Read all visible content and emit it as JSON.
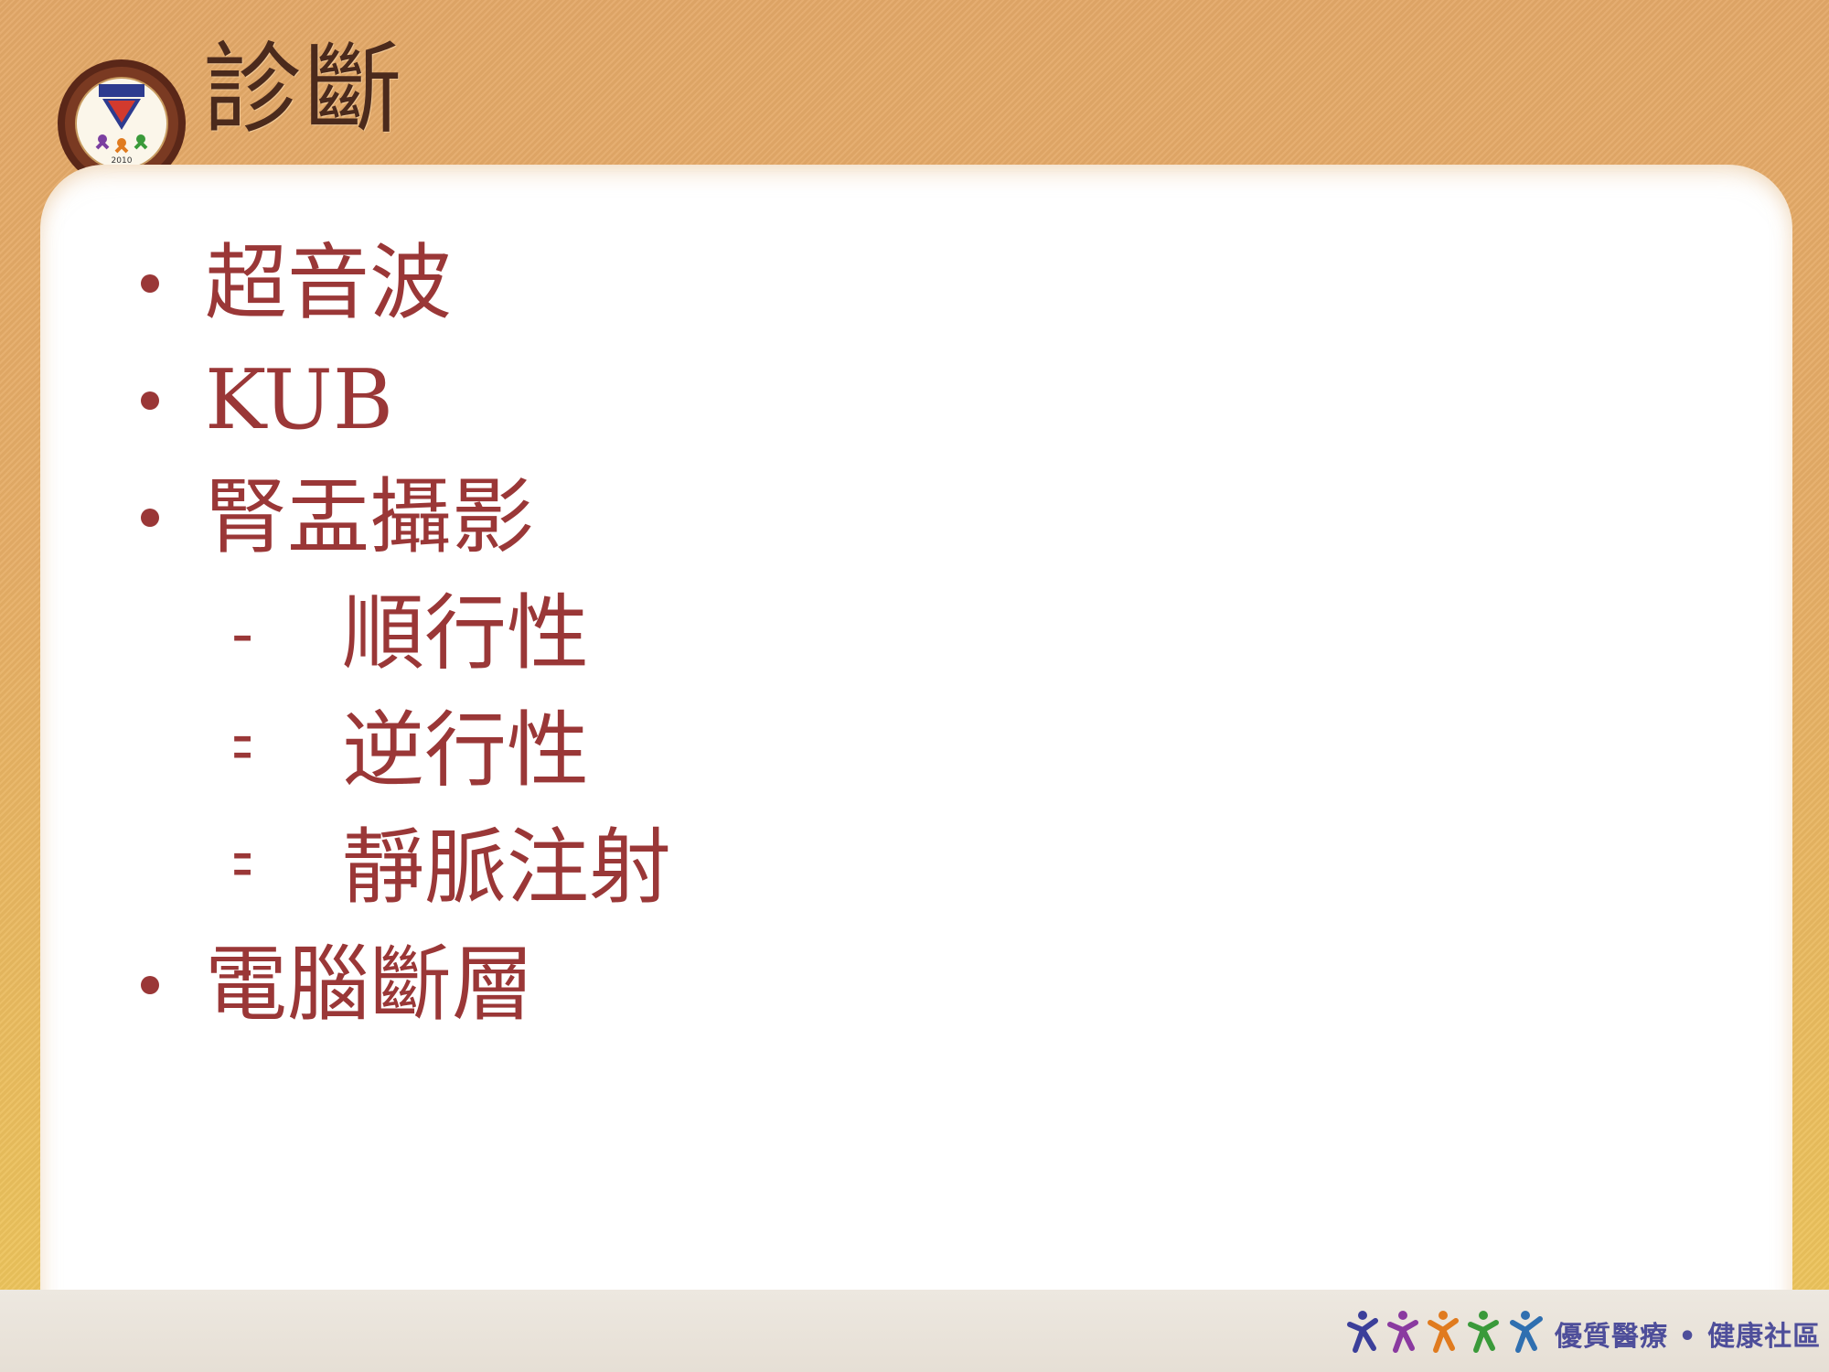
{
  "slide": {
    "title": "診斷",
    "bullets": [
      {
        "text": "超音波"
      },
      {
        "text": "KUB"
      },
      {
        "text": "腎盂攝影"
      },
      {
        "text": "電腦斷層"
      }
    ],
    "sub_items": [
      {
        "dash": "--",
        "text": "順行性"
      },
      {
        "dash": "--",
        "text": "逆行性"
      },
      {
        "dash": "--",
        "text": "靜脈注射"
      }
    ]
  },
  "footer": {
    "slogan": "優質醫療 • 健康社區",
    "figures_icon": "people-figures-icon"
  },
  "logo": {
    "icon": "hospital-seal-icon",
    "year_text": "2010"
  },
  "colors": {
    "title": "#4b2a1c",
    "body_text": "#9a3737",
    "background_top": "#e3a868",
    "background_bottom": "#edc65b",
    "footer_text": "#4e4e9a"
  }
}
